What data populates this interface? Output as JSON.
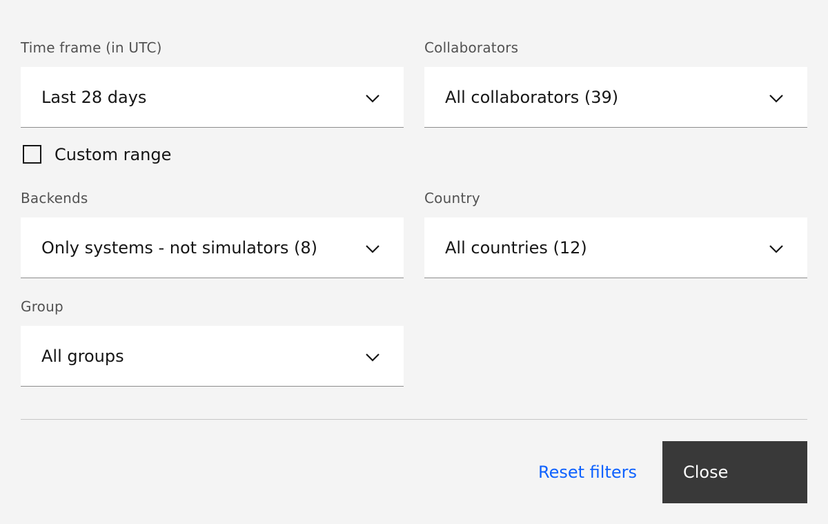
{
  "filters": {
    "timeframe": {
      "label": "Time frame (in UTC)",
      "value": "Last 28 days",
      "icon": "chevron-down-icon"
    },
    "custom_range": {
      "label": "Custom range",
      "checked": false
    },
    "collaborators": {
      "label": "Collaborators",
      "value": "All collaborators (39)",
      "icon": "chevron-down-icon"
    },
    "backends": {
      "label": "Backends",
      "value": "Only systems - not simulators (8)",
      "icon": "chevron-down-icon"
    },
    "country": {
      "label": "Country",
      "value": "All countries (12)",
      "icon": "chevron-down-icon"
    },
    "group": {
      "label": "Group",
      "value": "All groups",
      "icon": "chevron-down-icon"
    }
  },
  "actions": {
    "reset_label": "Reset filters",
    "close_label": "Close"
  },
  "colors": {
    "background": "#f4f4f4",
    "field_background": "#ffffff",
    "link": "#0f62fe",
    "primary_button": "#393939"
  }
}
